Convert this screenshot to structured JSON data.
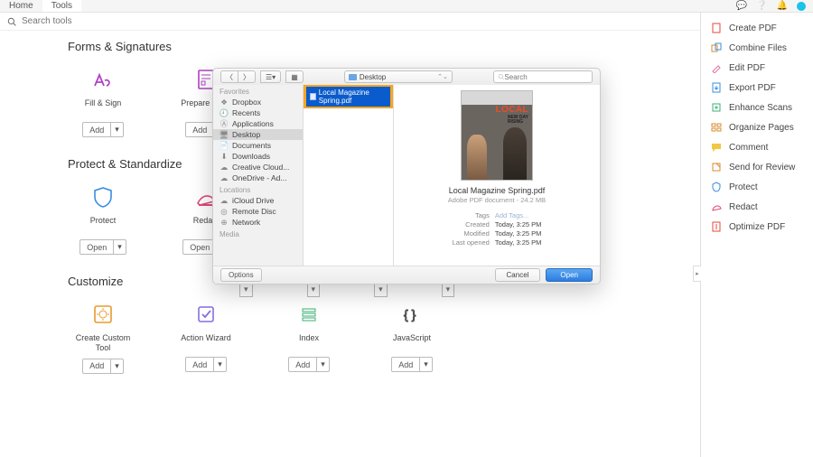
{
  "topbar": {
    "home": "Home",
    "tools": "Tools"
  },
  "search": {
    "placeholder": "Search tools"
  },
  "sections": {
    "forms": {
      "title": "Forms & Signatures",
      "fillSign": "Fill & Sign",
      "prepare": "Prepare Form"
    },
    "protect": {
      "title": "Protect & Standardize",
      "protect": "Protect",
      "redact": "Redact"
    },
    "customize": {
      "title": "Customize",
      "cct": "Create Custom Tool",
      "wizard": "Action Wizard",
      "index": "Index",
      "js": "JavaScript"
    }
  },
  "btn": {
    "add": "Add",
    "open": "Open",
    "caret": "▾"
  },
  "rightPanel": [
    "Create PDF",
    "Combine Files",
    "Edit PDF",
    "Export PDF",
    "Enhance Scans",
    "Organize Pages",
    "Comment",
    "Send for Review",
    "Protect",
    "Redact",
    "Optimize PDF"
  ],
  "dialog": {
    "location": "Desktop",
    "searchPlaceholder": "Search",
    "favoritesHead": "Favorites",
    "favorites": [
      "Dropbox",
      "Recents",
      "Applications",
      "Desktop",
      "Documents",
      "Downloads",
      "Creative Cloud...",
      "OneDrive - Ad..."
    ],
    "locationsHead": "Locations",
    "locations": [
      "iCloud Drive",
      "Remote Disc",
      "Network"
    ],
    "mediaHead": "Media",
    "fileSelected": "Local Magazine Spring.pdf",
    "preview": {
      "name": "Local Magazine Spring.pdf",
      "kind": "Adobe PDF document - 24.2 MB",
      "tagsLabel": "Tags",
      "tagsVal": "Add Tags...",
      "createdLabel": "Created",
      "createdVal": "Today, 3:25 PM",
      "modifiedLabel": "Modified",
      "modifiedVal": "Today, 3:25 PM",
      "openedLabel": "Last opened",
      "openedVal": "Today, 3:25 PM"
    },
    "thumb": {
      "local": "LOCAL",
      "sub1": "NEW DAY",
      "sub2": "RISING"
    },
    "buttons": {
      "options": "Options",
      "cancel": "Cancel",
      "open": "Open"
    }
  }
}
